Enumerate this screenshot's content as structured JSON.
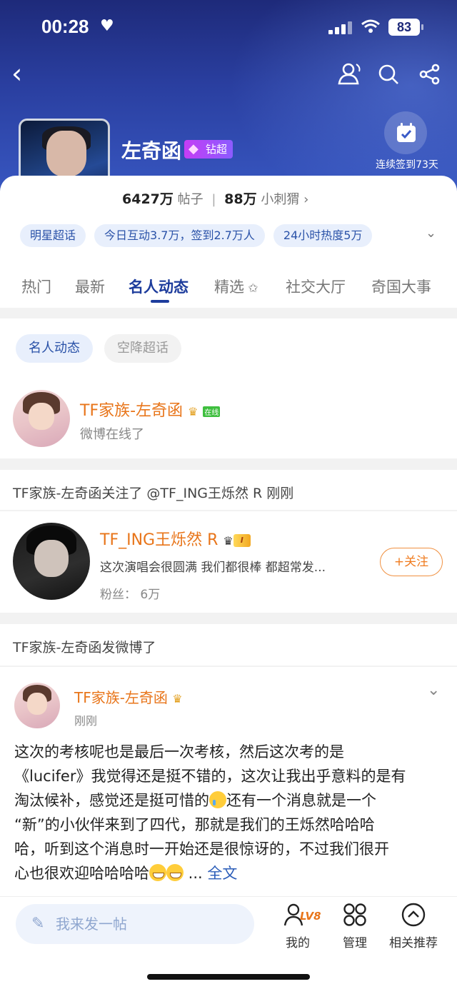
{
  "status_bar": {
    "time": "00:28",
    "battery": "83"
  },
  "header": {
    "name": "左奇函",
    "badge": "钻超",
    "checkin_label": "连续签到73天",
    "stats": {
      "posts_count": "6427万",
      "posts_label": "帖子",
      "fans_count": "88万",
      "fans_label": "小刺猬"
    }
  },
  "chips": [
    "明星超话",
    "今日互动3.7万，签到2.7万人",
    "24小时热度5万"
  ],
  "tabs": [
    "热门",
    "最新",
    "名人动态",
    "精选",
    "社交大厅",
    "奇国大事"
  ],
  "subtabs": [
    "名人动态",
    "空降超话"
  ],
  "online_card": {
    "name": "TF家族-左奇函",
    "online_badge": "在线",
    "status": "微博在线了"
  },
  "follow_section": {
    "header": "TF家族-左奇函关注了 @TF_ING王烁然 R 刚刚",
    "user": {
      "name": "TF_ING王烁然 R",
      "level": "I",
      "desc": "这次演唱会很圆满 我们都很棒 都超常发...",
      "fans": "粉丝： 6万",
      "follow_btn": "+关注"
    }
  },
  "post_section": {
    "header": "TF家族-左奇函发微博了",
    "author": "TF家族-左奇函",
    "time": "刚刚",
    "body_lines": [
      "这次的考核呢也是最后一次考核，然后这次考的是",
      "《lucifer》我觉得还是挺不错的，这次让我出乎意料的是有",
      "淘汰候补，感觉还是挺可惜的",
      "还有一个消息就是一个",
      "“新”的小伙伴来到了四代，那就是我们的王烁然哈哈哈",
      "哈，听到这个消息时一开始还是很惊讶的，不过我们很开",
      "心也很欢迎哈哈哈哈",
      " ...",
      "全文"
    ]
  },
  "bottom_bar": {
    "compose_placeholder": "我来发一帖",
    "level": "LV8",
    "items": [
      "我的",
      "管理",
      "相关推荐"
    ]
  }
}
